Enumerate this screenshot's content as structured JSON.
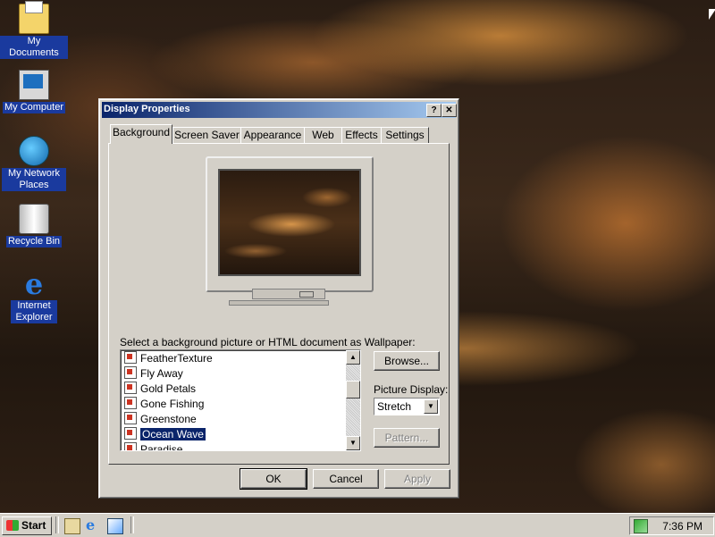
{
  "desktop": {
    "icons": [
      {
        "label": "My Documents",
        "icon": "my-documents-icon"
      },
      {
        "label": "My Computer",
        "icon": "my-computer-icon"
      },
      {
        "label": "My Network Places",
        "icon": "network-places-icon"
      },
      {
        "label": "Recycle Bin",
        "icon": "recycle-bin-icon"
      },
      {
        "label": "Internet Explorer",
        "icon": "internet-explorer-icon"
      }
    ]
  },
  "dialog": {
    "title": "Display Properties",
    "help_label": "?",
    "close_label": "✕",
    "tabs": [
      "Background",
      "Screen Saver",
      "Appearance",
      "Web",
      "Effects",
      "Settings"
    ],
    "active_tab": "Background",
    "prompt": "Select a background picture or HTML document as Wallpaper:",
    "wallpapers": [
      "FeatherTexture",
      "Fly Away",
      "Gold Petals",
      "Gone Fishing",
      "Greenstone",
      "Ocean Wave",
      "Paradise"
    ],
    "selected_wallpaper": "Ocean Wave",
    "browse_label": "Browse...",
    "picture_display_label": "Picture Display:",
    "picture_display_value": "Stretch",
    "pattern_label": "Pattern...",
    "ok_label": "OK",
    "cancel_label": "Cancel",
    "apply_label": "Apply"
  },
  "taskbar": {
    "start_label": "Start",
    "clock": "7:36 PM",
    "quick_launch": [
      "show-desktop-icon",
      "internet-explorer-icon",
      "outlook-express-icon"
    ]
  },
  "colors": {
    "titlebar_start": "#0a246a",
    "titlebar_end": "#a6caf0",
    "face": "#d4d0c8",
    "selection": "#0a246a",
    "desktop_label_bg": "#1a3a9e"
  }
}
